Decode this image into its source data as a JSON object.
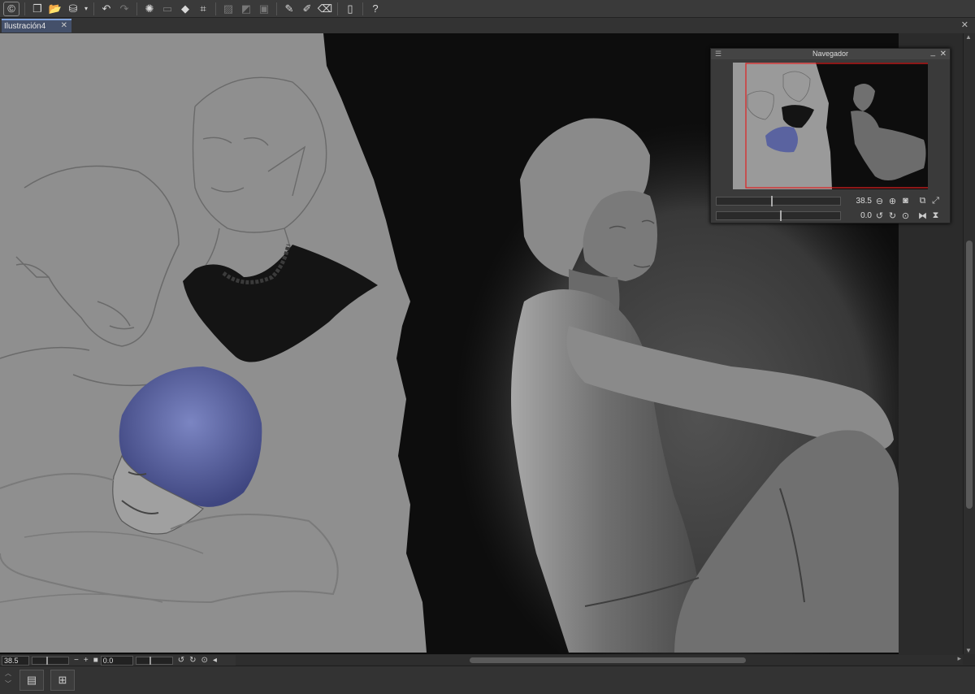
{
  "toolbar": {
    "icons": [
      "app-logo-icon",
      "new-file-icon",
      "open-folder-icon",
      "save-icon",
      "dropdown-arrow-icon",
      "undo-icon",
      "redo-icon",
      "loading-spinner-icon",
      "clear-icon",
      "fill-icon",
      "crop-icon",
      "select-all-icon",
      "invert-selection-icon",
      "deselect-icon",
      "pen-tool-icon",
      "brush-tool-icon",
      "eraser-tool-icon",
      "smartphone-icon",
      "help-icon"
    ]
  },
  "document": {
    "tab_label": "Ilustración4",
    "tab_close": "✕",
    "window_close": "✕"
  },
  "navigator": {
    "title": "Navegador",
    "zoom_value": "38.5",
    "rotate_value": "0.0",
    "zoom_percent": 45,
    "rotate_percent": 52
  },
  "status_bar": {
    "zoom_value": "38.5",
    "rotate_value": "0.0",
    "minus": "−",
    "plus": "+",
    "zoom_percent": 40,
    "rotate_percent": 40
  },
  "colors": {
    "accent": "#7ea0d8",
    "nav_frame": "#e02020",
    "canvas_gray": "#8f8f8f",
    "canvas_dark": "#0d0d0d",
    "hair_blue": "#5a63a0"
  }
}
